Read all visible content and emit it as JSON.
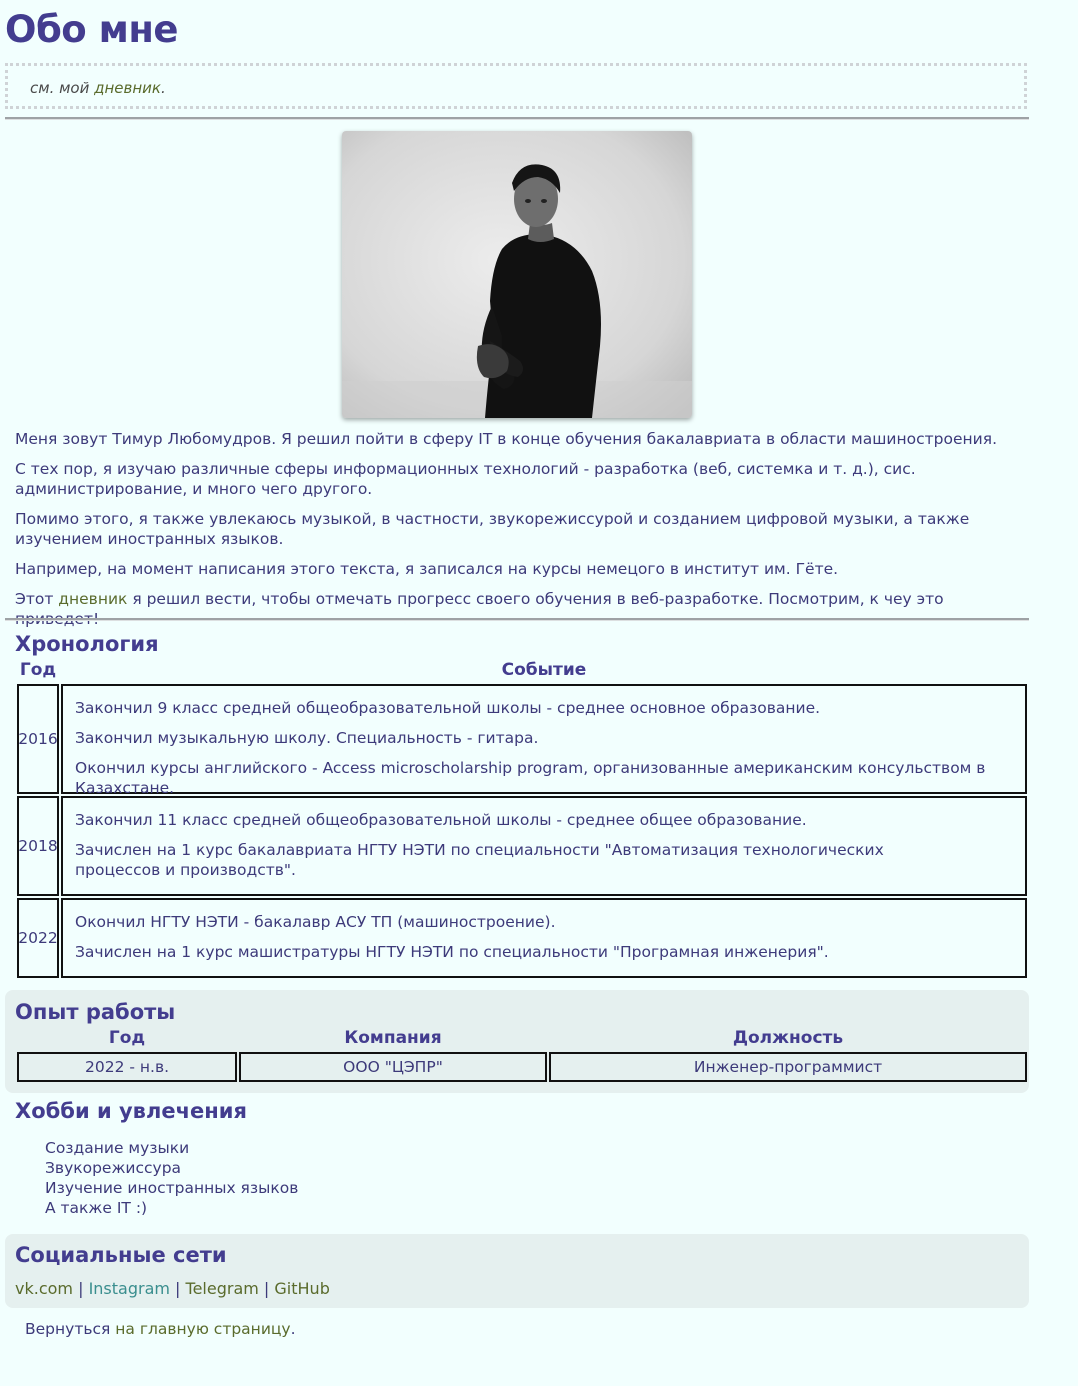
{
  "header": {
    "title": "Обо мне"
  },
  "note": {
    "prefix": "см. мой ",
    "link": "дневник",
    "suffix": "."
  },
  "intro": {
    "p1": "Меня зовут Тимур Любомудров. Я решил пойти в сферу IT в конце обучения бакалавриата в области машиностроения.",
    "p2": "С тех пор, я изучаю различные сферы информационных технологий - разработка (веб, системка и т. д.), сис. администрирование, и много чего другого.",
    "p3": "Помимо этого, я также увлекаюсь музыкой, в частности, звукорежиссурой и созданием цифровой музыки, а также изучением иностранных языков.",
    "p4": "Например, на момент написания этого текста, я записался на курсы немецого в институт им. Гёте.",
    "p5_prefix": "Этот ",
    "p5_link": "дневник",
    "p5_suffix": " я решил вести, чтобы отмечать прогресс своего обучения в веб-разработке. Посмотрим, к чеу это приведет!"
  },
  "timeline": {
    "title": "Хронология",
    "col_year": "Год",
    "col_event": "Событие",
    "rows": [
      {
        "year": "2016",
        "events": [
          "Закончил 9 класс средней общеобразовательной школы - среднее основное образование.",
          "Закончил музыкальную школу. Специальность - гитара.",
          "Окончил курсы английского - Access microscholarship program, организованные американским консульством в Казахстане."
        ]
      },
      {
        "year": "2018",
        "events": [
          "Закончил 11 класс средней общеобразовательной школы - среднее общее образование.",
          "Зачислен на 1 курс бакалавриата НГТУ НЭТИ по специальности \"Автоматизация технологических процессов и производств\"."
        ]
      },
      {
        "year": "2022",
        "events": [
          "Окончил НГТУ НЭТИ - бакалавр АСУ ТП (машиностроение).",
          "Зачислен на 1 курс машистратуры НГТУ НЭТИ по специальности \"Програмная инженерия\"."
        ]
      }
    ]
  },
  "work": {
    "title": "Опыт работы",
    "col_year": "Год",
    "col_company": "Компания",
    "col_position": "Должность",
    "rows": [
      {
        "year": "2022 - н.в.",
        "company": "ООО \"ЦЭПР\"",
        "position": "Инженер-программист"
      }
    ]
  },
  "hobbies": {
    "title": "Хобби и увлечения",
    "items": [
      "Создание музыки",
      "Звукорежиссура",
      "Изучение иностранных языков",
      "А также IT :)"
    ]
  },
  "social": {
    "title": "Социальные сети",
    "links": [
      "vk.com",
      "Instagram",
      "Telegram",
      "GitHub"
    ],
    "separator": " | "
  },
  "footer": {
    "prefix": "Вернуться ",
    "link": "на главную страницу",
    "suffix": "."
  },
  "colors": {
    "background": "#f2fffe",
    "heading": "#433d8f",
    "text": "#3d3a7a",
    "link": "#5a6b2c",
    "link_visited": "#3a8e8e",
    "panel": "#e5f0ef"
  }
}
